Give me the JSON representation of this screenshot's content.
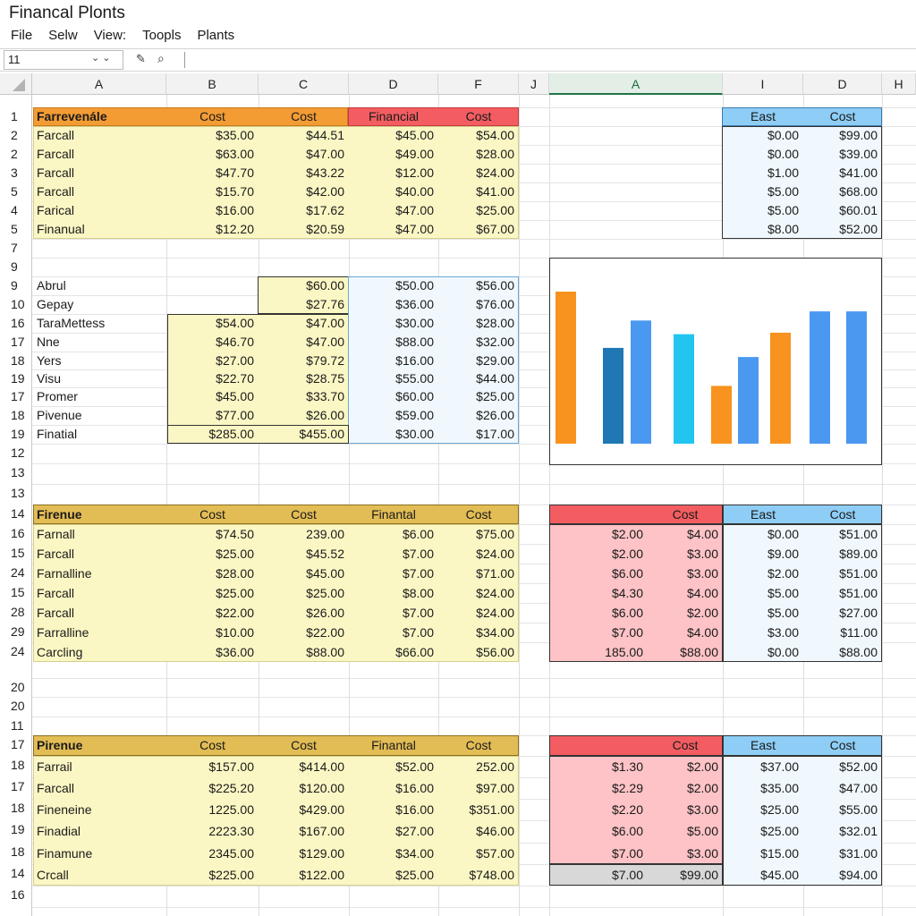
{
  "window": {
    "title": "Financal   Plonts"
  },
  "menu": [
    "File",
    "Selw",
    "View:",
    "Toopls",
    "Plants"
  ],
  "formula_bar": {
    "name_box": "11",
    "formula": ""
  },
  "columns": [
    "A",
    "B",
    "C",
    "D",
    "F",
    "J",
    "A",
    "I",
    "D",
    "H"
  ],
  "row_numbers": [
    "1",
    "2",
    "2",
    "3",
    "5",
    "4",
    "5",
    "7",
    "9",
    "9",
    "10",
    "16",
    "17",
    "18",
    "19",
    "17",
    "18",
    "19",
    "12",
    "13",
    "13",
    "14",
    "16",
    "15",
    "24",
    "15",
    "28",
    "29",
    "24",
    "20",
    "20",
    "11",
    "17",
    "18",
    "17",
    "18",
    "19",
    "18",
    "14",
    "16"
  ],
  "table1": {
    "headers": [
      "Farrevenále",
      "Cost",
      "Cost",
      "Financial",
      "Cost"
    ],
    "rows": [
      [
        "Farcall",
        "$35.00",
        "$44.51",
        "$45.00",
        "$54.00"
      ],
      [
        "Farcall",
        "$63.00",
        "$47.00",
        "$49.00",
        "$28.00"
      ],
      [
        "Farcall",
        "$47.70",
        "$43.22",
        "$12.00",
        "$24.00"
      ],
      [
        "Farcall",
        "$15.70",
        "$42.00",
        "$40.00",
        "$41.00"
      ],
      [
        "Farical",
        "$16.00",
        "$17.62",
        "$47.00",
        "$25.00"
      ],
      [
        "Finanual",
        "$12.20",
        "$20.59",
        "$47.00",
        "$67.00"
      ]
    ]
  },
  "table_east1": {
    "headers": [
      "East",
      "Cost"
    ],
    "rows": [
      [
        "$0.00",
        "$99.00"
      ],
      [
        "$0.00",
        "$39.00"
      ],
      [
        "$1.00",
        "$41.00"
      ],
      [
        "$5.00",
        "$68.00"
      ],
      [
        "$5.00",
        "$60.01"
      ],
      [
        "$8.00",
        "$52.00"
      ]
    ]
  },
  "table2": {
    "rows": [
      [
        "Abrul",
        "",
        "$60.00",
        "$50.00",
        "$56.00"
      ],
      [
        "Gepay",
        "",
        "$27.76",
        "$36.00",
        "$76.00"
      ],
      [
        "TaraMettess",
        "$54.00",
        "$47.00",
        "$30.00",
        "$28.00"
      ],
      [
        "Nne",
        "$46.70",
        "$47.00",
        "$88.00",
        "$32.00"
      ],
      [
        "Yers",
        "$27.00",
        "$79.72",
        "$16.00",
        "$29.00"
      ],
      [
        "Visu",
        "$22.70",
        "$28.75",
        "$55.00",
        "$44.00"
      ],
      [
        "Promer",
        "$45.00",
        "$33.70",
        "$60.00",
        "$25.00"
      ],
      [
        "Pivenue",
        "$77.00",
        "$26.00",
        "$59.00",
        "$26.00"
      ],
      [
        "Finatial",
        "$285.00",
        "$455.00",
        "$30.00",
        "$17.00"
      ]
    ]
  },
  "table3": {
    "headers": [
      "Firenue",
      "Cost",
      "Cost",
      "Finantal",
      "Cost"
    ],
    "rows": [
      [
        "Farnall",
        "$74.50",
        "239.00",
        "$6.00",
        "$75.00"
      ],
      [
        "Farcall",
        "$25.00",
        "$45.52",
        "$7.00",
        "$24.00"
      ],
      [
        "Farnalline",
        "$28.00",
        "$45.00",
        "$7.00",
        "$71.00"
      ],
      [
        "Farcall",
        "$25.00",
        "$25.00",
        "$8.00",
        "$24.00"
      ],
      [
        "Farcall",
        "$22.00",
        "$26.00",
        "$7.00",
        "$24.00"
      ],
      [
        "Farralline",
        "$10.00",
        "$22.00",
        "$7.00",
        "$34.00"
      ],
      [
        "Carcling",
        "$36.00",
        "$88.00",
        "$66.00",
        "$56.00"
      ]
    ]
  },
  "table4": {
    "headers": [
      "",
      "Cost",
      "East",
      "Cost"
    ],
    "rows": [
      [
        "$2.00",
        "$4.00",
        "$0.00",
        "$51.00"
      ],
      [
        "$2.00",
        "$3.00",
        "$9.00",
        "$89.00"
      ],
      [
        "$6.00",
        "$3.00",
        "$2.00",
        "$51.00"
      ],
      [
        "$4.30",
        "$4.00",
        "$5.00",
        "$51.00"
      ],
      [
        "$6.00",
        "$2.00",
        "$5.00",
        "$27.00"
      ],
      [
        "$7.00",
        "$4.00",
        "$3.00",
        "$11.00"
      ],
      [
        "185.00",
        "$88.00",
        "$0.00",
        "$88.00"
      ]
    ]
  },
  "table5": {
    "headers": [
      "Pirenue",
      "Cost",
      "Cost",
      "Finantal",
      "Cost"
    ],
    "rows": [
      [
        "Farrail",
        "$157.00",
        "$414.00",
        "$52.00",
        "252.00"
      ],
      [
        "Farcall",
        "$225.20",
        "$120.00",
        "$16.00",
        "$97.00"
      ],
      [
        "Fineneine",
        "1225.00",
        "$429.00",
        "$16.00",
        "$351.00"
      ],
      [
        "Finadial",
        "2223.30",
        "$167.00",
        "$27.00",
        "$46.00"
      ],
      [
        "Finamune",
        "2345.00",
        "$129.00",
        "$34.00",
        "$57.00"
      ],
      [
        "Crcall",
        "$225.00",
        "$122.00",
        "$25.00",
        "$748.00"
      ]
    ]
  },
  "table6": {
    "headers": [
      "",
      "Cost",
      "East",
      "Cost"
    ],
    "rows": [
      [
        "$1.30",
        "$2.00",
        "$37.00",
        "$52.00"
      ],
      [
        "$2.29",
        "$2.00",
        "$35.00",
        "$47.00"
      ],
      [
        "$2.20",
        "$3.00",
        "$25.00",
        "$55.00"
      ],
      [
        "$6.00",
        "$5.00",
        "$25.00",
        "$32.01"
      ],
      [
        "$7.00",
        "$3.00",
        "$15.00",
        "$31.00"
      ],
      [
        "$7.00",
        "$99.00",
        "$45.00",
        "$94.00"
      ]
    ]
  },
  "colors": {
    "orange": "#f39c34",
    "red": "#f35d61",
    "yellow_header": "#e2bc55",
    "yellow_fill": "#fbf7c4",
    "blue_header": "#8ecdf5",
    "blue_fill": "#f0f8fd",
    "pink_fill": "#fdc3c6",
    "grey_fill": "#d8d8d8"
  },
  "chart_data": {
    "type": "bar",
    "title": "",
    "xlabel": "",
    "ylabel": "",
    "ylim": [
      0,
      100
    ],
    "grid": false,
    "values": [
      100,
      63,
      81,
      72,
      38,
      57,
      73,
      87,
      87
    ],
    "colors": [
      "#f7931e",
      "#1f77b4",
      "#4a98f0",
      "#22c5f0",
      "#f7931e",
      "#4a98f0",
      "#f7931e",
      "#4a98f0",
      "#4a98f0"
    ]
  }
}
